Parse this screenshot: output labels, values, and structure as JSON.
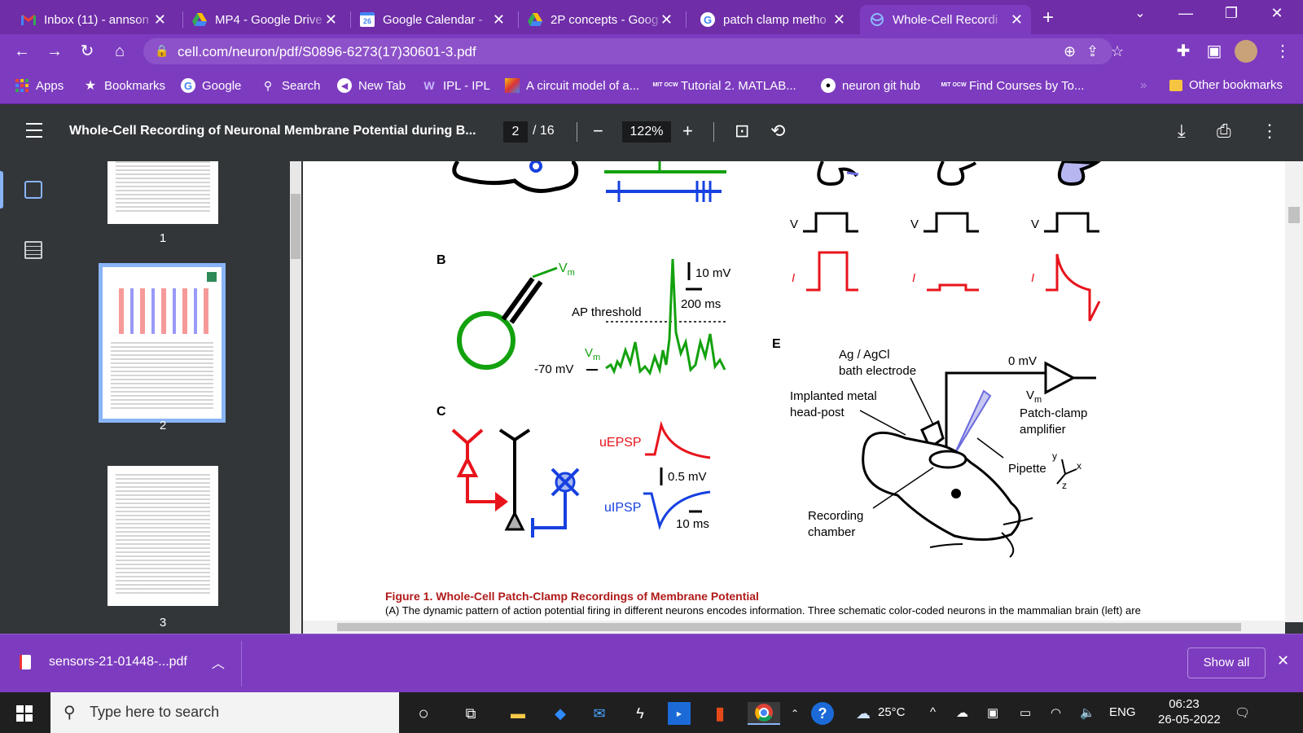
{
  "tabs": [
    {
      "title": "Inbox (11) - annson",
      "icon": "gmail-icon"
    },
    {
      "title": "MP4 - Google Drive",
      "icon": "drive-icon"
    },
    {
      "title": "Google Calendar -",
      "icon": "calendar-icon",
      "badge": "26"
    },
    {
      "title": "2P concepts - Goog",
      "icon": "drive-icon"
    },
    {
      "title": "patch clamp metho",
      "icon": "google-icon"
    },
    {
      "title": "Whole-Cell Recordi",
      "icon": "web-icon",
      "active": true
    }
  ],
  "address": {
    "url": "cell.com/neuron/pdf/S0896-6273(17)30601-3.pdf"
  },
  "bookmarks": [
    {
      "label": "Apps",
      "icon": "apps-grid-icon"
    },
    {
      "label": "Bookmarks",
      "icon": "star-icon"
    },
    {
      "label": "Google",
      "icon": "google-icon"
    },
    {
      "label": "Search",
      "icon": "search-icon"
    },
    {
      "label": "New Tab",
      "icon": "newtab-icon"
    },
    {
      "label": "IPL - IPL",
      "icon": "w-icon"
    },
    {
      "label": "A circuit model of a...",
      "icon": "pdf-color-icon"
    },
    {
      "label": "Tutorial 2. MATLAB...",
      "icon": "mit-ocw-icon",
      "badge": "MIT OCW"
    },
    {
      "label": "neuron git hub",
      "icon": "github-icon"
    },
    {
      "label": "Find Courses by To...",
      "icon": "mit-ocw-icon",
      "badge": "MIT OCW"
    },
    {
      "label": "Other bookmarks",
      "icon": "folder-icon"
    }
  ],
  "pdf": {
    "title": "Whole-Cell Recording of Neuronal Membrane Potential during B...",
    "page": "2",
    "page_total": "/ 16",
    "zoom": "122%"
  },
  "thumbnails": [
    {
      "num": "1"
    },
    {
      "num": "2"
    },
    {
      "num": "3"
    }
  ],
  "figure": {
    "panel_b": "B",
    "panel_c": "C",
    "panel_e": "E",
    "v": "V",
    "i": "I",
    "vm": "V",
    "vm_sub": "m",
    "scale_10mv": "10 mV",
    "scale_200ms": "200 ms",
    "ap_threshold": "AP threshold",
    "minus70": "-70 mV",
    "uepsp": "uEPSP",
    "uipsp": "uIPSP",
    "scale_05mv": "0.5 mV",
    "scale_10ms": "10 ms",
    "ag_line1": "Ag / AgCl",
    "ag_line2": "bath electrode",
    "zero_mv": "0 mV",
    "implant_line1": "Implanted metal",
    "implant_line2": "head-post",
    "patch_line1": "Patch-clamp",
    "patch_line2": "amplifier",
    "pipette": "Pipette",
    "rec_line1": "Recording",
    "rec_line2": "chamber",
    "axis_x": "x",
    "axis_y": "y",
    "axis_z": "z",
    "caption_title": "Figure 1.  Whole-Cell Patch-Clamp Recordings of Membrane Potential",
    "caption_text": "(A) The dynamic pattern of action potential firing in different neurons encodes information. Three schematic color-coded neurons in the mammalian brain (left) are"
  },
  "download": {
    "filename": "sensors-21-01448-...pdf",
    "show_all": "Show all"
  },
  "taskbar": {
    "search_placeholder": "Type here to search",
    "temperature": "25°C",
    "language": "ENG",
    "time": "06:23",
    "date": "26-05-2022"
  },
  "colors": {
    "chrome": "#7d3cbf",
    "tabstrip": "#6f2da8",
    "green": "#13a10e",
    "red": "#e8141c",
    "blue": "#1640e0",
    "caption_red": "#b01a1a"
  }
}
